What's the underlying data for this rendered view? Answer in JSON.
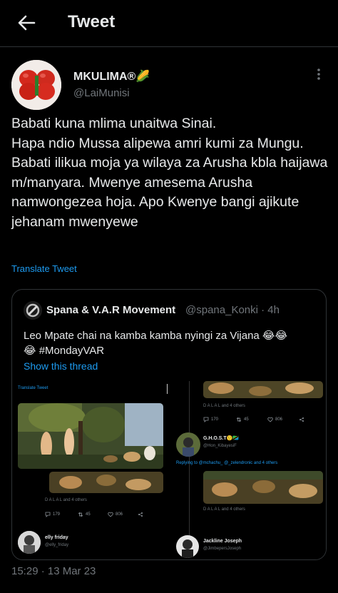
{
  "header": {
    "back_icon": "arrow-left-icon",
    "title": "Tweet"
  },
  "tweet": {
    "author_name": "MKULIMA®🌽",
    "author_handle": "@LaiMunisi",
    "text": "Babati kuna mlima unaitwa Sinai.\nHapa ndio Mussa alipewa amri kumi za Mungu. Babati ilikua moja ya wilaya za Arusha kbla haijawa m/manyara. Mwenye amesema Arusha namwongezea hoja. Apo Kwenye bangi ajikute jehanam mwenyewe",
    "translate_label": "Translate Tweet",
    "timestamp": "15:29 · 13 Mar 23"
  },
  "quote": {
    "author_name": "Spana & V.A.R Movement",
    "author_handle": "@spana_Konki · 4h",
    "text": "Leo Mpate chai na kamba kamba nyingi za Vijana 😂😂\n😂 #MondayVAR",
    "show_thread": "Show this thread",
    "media": {
      "left": {
        "translate_label": "Translate Tweet",
        "liked_by": "D A L A L   and 4 others",
        "replies": "179",
        "retweets": "45",
        "likes": "806",
        "reply_name": "elly friday",
        "reply_handle": "@elly_friday"
      },
      "right": {
        "liked_by_top": "D A L A L   and 4 others",
        "replies_top": "170",
        "retweets_top": "45",
        "likes_top": "806",
        "user_name": "G.H.O.S.T🙂🇹🇿",
        "user_handle": "@Hon_KibayesiF",
        "replying_to": "Replying to @mchachu_ @_zelendronic and 4 others",
        "liked_by": "D A L A L   and 4 others",
        "bottom_name": "Jackline Joseph",
        "bottom_handle": "@JimbepersJoseph"
      }
    }
  },
  "icons": [
    "arrow-left-icon",
    "more-dots-icon",
    "reply-icon",
    "retweet-icon",
    "like-icon",
    "share-icon"
  ],
  "colors": {
    "background": "#000000",
    "text": "#e7e9ea",
    "secondary": "#71767b",
    "link": "#1d9bf0",
    "border": "#2f3336"
  }
}
